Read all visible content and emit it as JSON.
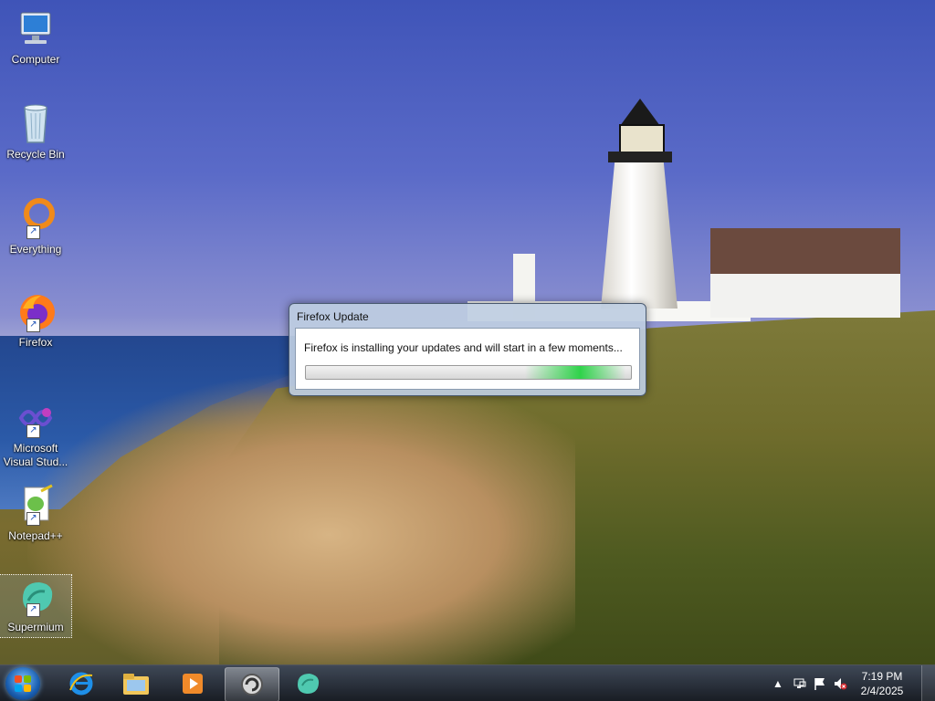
{
  "desktop": {
    "icons": [
      {
        "label": "Computer",
        "icon": "computer-icon"
      },
      {
        "label": "Recycle Bin",
        "icon": "recycle-bin-icon"
      },
      {
        "label": "Everything",
        "icon": "everything-icon",
        "shortcut": true
      },
      {
        "label": "Firefox",
        "icon": "firefox-icon",
        "shortcut": true
      },
      {
        "label": "Microsoft Visual Stud...",
        "icon": "visual-studio-icon",
        "shortcut": true
      },
      {
        "label": "Notepad++",
        "icon": "notepadpp-icon",
        "shortcut": true
      },
      {
        "label": "Supermium",
        "icon": "supermium-icon",
        "shortcut": true,
        "selected": true
      }
    ]
  },
  "dialog": {
    "title": "Firefox Update",
    "message": "Firefox is installing your updates and will start in a few moments..."
  },
  "taskbar": {
    "start_icon": "windows-start-icon",
    "pinned": [
      {
        "name": "internet-explorer-icon"
      },
      {
        "name": "file-explorer-icon"
      },
      {
        "name": "media-player-icon"
      },
      {
        "name": "firefox-update-icon",
        "active": true
      },
      {
        "name": "supermium-icon"
      }
    ],
    "tray": {
      "time": "7:19 PM",
      "date": "2/4/2025",
      "icons": [
        "show-hidden-icons-arrow",
        "network-icon",
        "action-center-flag-icon",
        "volume-muted-icon"
      ]
    }
  },
  "colors": {
    "accent": "#2fd34a",
    "dialog_frame": "#bed0e6",
    "taskbar": "#1e2838"
  }
}
